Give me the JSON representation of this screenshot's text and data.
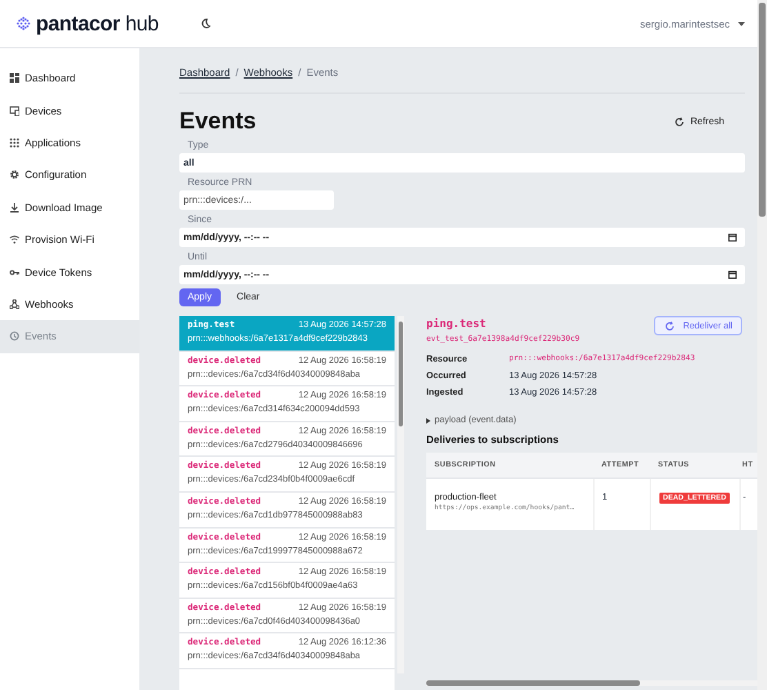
{
  "header": {
    "logo": "**pantacor** hub",
    "user": "sergio.marintestsec"
  },
  "sidebar": {
    "items": [
      {
        "label": "Dashboard",
        "selected": false
      },
      {
        "label": "Devices",
        "selected": false
      },
      {
        "label": "Applications",
        "selected": false
      },
      {
        "label": "Configuration",
        "selected": false
      },
      {
        "label": "Download Image",
        "selected": false
      },
      {
        "label": "Provision Wi-Fi",
        "selected": false
      },
      {
        "label": "Device Tokens",
        "selected": false
      },
      {
        "label": "Webhooks",
        "selected": false
      },
      {
        "label": "Events",
        "selected": true
      }
    ]
  },
  "breadcrumb": [
    {
      "label": "Dashboard",
      "link": true
    },
    {
      "label": "Webhooks",
      "link": true,
      "separator": "/"
    },
    {
      "label": "Events",
      "link": false,
      "separator": "/"
    }
  ],
  "page": {
    "title": "Events",
    "refresh": "Refresh"
  },
  "filters": {
    "type": {
      "label": "Type",
      "value": "all"
    },
    "resource": {
      "label": "Resource PRN",
      "placeholder": "prn:::devices:/..."
    },
    "since": {
      "label": "Since",
      "placeholder": "mm/dd/yyyy, --:-- --"
    },
    "until": {
      "label": "Until",
      "placeholder": "mm/dd/yyyy, --:-- --"
    },
    "apply": "Apply",
    "clear": "Clear"
  },
  "events": [
    {
      "type": "ping.test",
      "time": "13 Aug 2026 14:57:28",
      "prn": "prn:::webhooks:/6a7e1317a4df9cef229b2843",
      "selected": true
    },
    {
      "type": "device.deleted",
      "time": "12 Aug 2026 16:58:19",
      "prn": "prn:::devices:/6a7cd34f6d40340009848aba",
      "selected": false
    },
    {
      "type": "device.deleted",
      "time": "12 Aug 2026 16:58:19",
      "prn": "prn:::devices:/6a7cd314f634c200094dd593",
      "selected": false
    },
    {
      "type": "device.deleted",
      "time": "12 Aug 2026 16:58:19",
      "prn": "prn:::devices:/6a7cd2796d40340009846696",
      "selected": false
    },
    {
      "type": "device.deleted",
      "time": "12 Aug 2026 16:58:19",
      "prn": "prn:::devices:/6a7cd234bf0b4f0009ae6cdf",
      "selected": false
    },
    {
      "type": "device.deleted",
      "time": "12 Aug 2026 16:58:19",
      "prn": "prn:::devices:/6a7cd1db977845000988ab83",
      "selected": false
    },
    {
      "type": "device.deleted",
      "time": "12 Aug 2026 16:58:19",
      "prn": "prn:::devices:/6a7cd199977845000988a672",
      "selected": false
    },
    {
      "type": "device.deleted",
      "time": "12 Aug 2026 16:58:19",
      "prn": "prn:::devices:/6a7cd156bf0b4f0009ae4a63",
      "selected": false
    },
    {
      "type": "device.deleted",
      "time": "12 Aug 2026 16:58:19",
      "prn": "prn:::devices:/6a7cd0f46d403400098436a0",
      "selected": false
    },
    {
      "type": "device.deleted",
      "time": "12 Aug 2026 16:12:36",
      "prn": "prn:::devices:/6a7cd34f6d40340009848aba",
      "selected": false
    }
  ],
  "detail": {
    "type": "ping.test",
    "id": "evt_test_6a7e1398a4df9cef229b30c9",
    "redeliver": "Redeliver all",
    "fields": [
      {
        "label": "Resource",
        "value": "prn:::webhooks:/6a7e1317a4df9cef229b2843",
        "kind": "code"
      },
      {
        "label": "Occurred",
        "value": "13 Aug 2026 14:57:28",
        "kind": "text"
      },
      {
        "label": "Ingested",
        "value": "13 Aug 2026 14:57:28",
        "kind": "text"
      }
    ],
    "payload": "payload (event.data)",
    "payload_expanded": false,
    "deliveries_title": "Deliveries to subscriptions",
    "table": {
      "columns": [
        "SUBSCRIPTION",
        "ATTEMPT",
        "STATUS",
        "HT"
      ],
      "rows": [
        {
          "name": "production-fleet",
          "url": "https://ops.example.com/hooks/pant…",
          "attempt": "1",
          "status": "DEAD_LETTERED",
          "column_4": "-"
        }
      ]
    }
  }
}
